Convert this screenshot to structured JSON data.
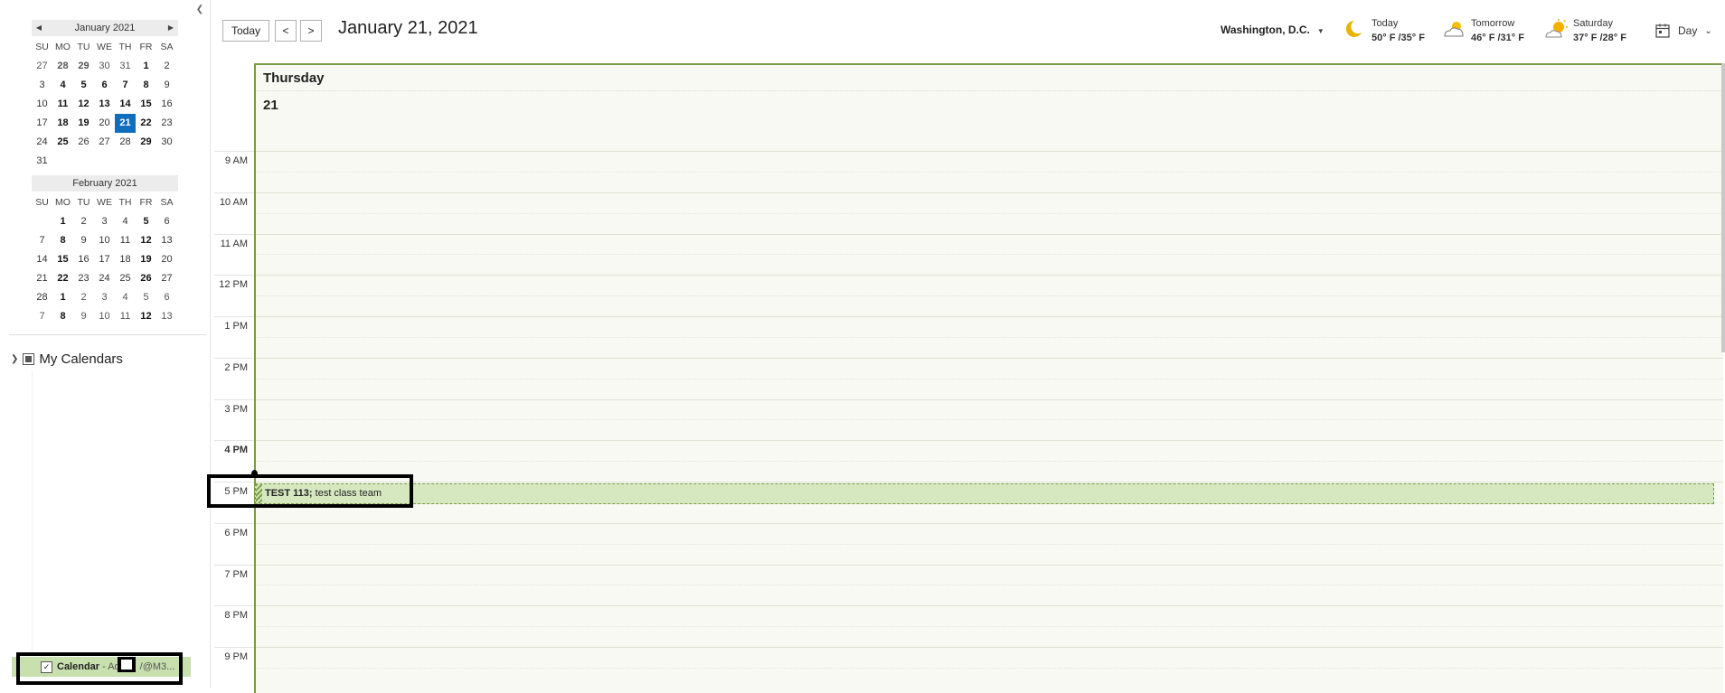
{
  "minical_jan": {
    "title": "January 2021",
    "dow": [
      "SU",
      "MO",
      "TU",
      "WE",
      "TH",
      "FR",
      "SA"
    ],
    "weeks": [
      [
        "27",
        "28",
        "29",
        "30",
        "31",
        "1",
        "2"
      ],
      [
        "3",
        "4",
        "5",
        "6",
        "7",
        "8",
        "9"
      ],
      [
        "10",
        "11",
        "12",
        "13",
        "14",
        "15",
        "16"
      ],
      [
        "17",
        "18",
        "19",
        "20",
        "21",
        "22",
        "23"
      ],
      [
        "24",
        "25",
        "26",
        "27",
        "28",
        "29",
        "30"
      ],
      [
        "31",
        "",
        "",
        "",
        "",
        "",
        ""
      ]
    ]
  },
  "minical_feb": {
    "title": "February 2021",
    "dow": [
      "SU",
      "MO",
      "TU",
      "WE",
      "TH",
      "FR",
      "SA"
    ],
    "weeks": [
      [
        "",
        "1",
        "2",
        "3",
        "4",
        "5",
        "6"
      ],
      [
        "7",
        "8",
        "9",
        "10",
        "11",
        "12",
        "13"
      ],
      [
        "14",
        "15",
        "16",
        "17",
        "18",
        "19",
        "20"
      ],
      [
        "21",
        "22",
        "23",
        "24",
        "25",
        "26",
        "27"
      ],
      [
        "28",
        "1",
        "2",
        "3",
        "4",
        "5",
        "6"
      ],
      [
        "7",
        "8",
        "9",
        "10",
        "11",
        "12",
        "13"
      ]
    ]
  },
  "sidebar": {
    "section_title": "My Calendars",
    "calendar_item": {
      "name": "Calendar",
      "account_prefix": "- Ad",
      "account_suffix": "/@M3..."
    }
  },
  "toolbar": {
    "today_label": "Today",
    "prev_label": "<",
    "next_label": ">",
    "current_date": "January 21, 2021",
    "location": "Washington,  D.C.",
    "view_label": "Day"
  },
  "weather": [
    {
      "label": "Today",
      "temps": "50° F /35° F",
      "icon": "moon-icon"
    },
    {
      "label": "Tomorrow",
      "temps": "46° F /31° F",
      "icon": "partly-cloudy-icon"
    },
    {
      "label": "Saturday",
      "temps": "37° F /28° F",
      "icon": "partly-sunny-icon"
    }
  ],
  "day": {
    "name": "Thursday",
    "number": "21"
  },
  "times": [
    "9 AM",
    "10 AM",
    "11 AM",
    "12 PM",
    "1 PM",
    "2 PM",
    "3 PM",
    "4 PM",
    "5 PM",
    "6 PM",
    "7 PM",
    "8 PM",
    "9 PM"
  ],
  "event": {
    "title": "TEST 113;",
    "subtitle": "test  class team"
  },
  "colors": {
    "accent": "#7a9b47",
    "selected_day": "#106ebe",
    "event_bg": "#d6e8c0",
    "calendar_item_bg": "#c8dfae"
  }
}
